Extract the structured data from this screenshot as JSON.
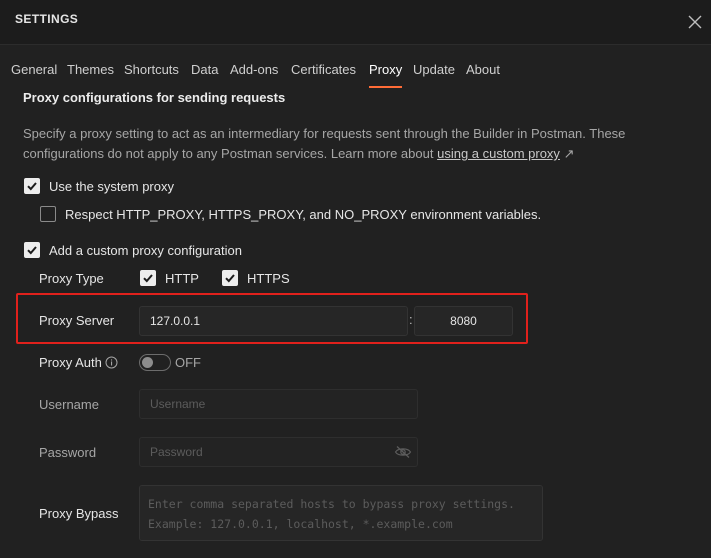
{
  "window": {
    "title": "SETTINGS"
  },
  "tabs": [
    {
      "label": "General"
    },
    {
      "label": "Themes"
    },
    {
      "label": "Shortcuts"
    },
    {
      "label": "Data"
    },
    {
      "label": "Add-ons"
    },
    {
      "label": "Certificates"
    },
    {
      "label": "Proxy",
      "active": true
    },
    {
      "label": "Update"
    },
    {
      "label": "About"
    }
  ],
  "section": {
    "title": "Proxy configurations for sending requests",
    "description": "Specify a proxy setting to act as an intermediary for requests sent through the Builder in Postman. These configurations do not apply to any Postman services. Learn more about",
    "link_text": "using a custom proxy",
    "link_arrow": "↗"
  },
  "system_proxy": {
    "label": "Use the system proxy",
    "checked": true
  },
  "respect_env": {
    "label": "Respect HTTP_PROXY, HTTPS_PROXY, and NO_PROXY environment variables.",
    "checked": false
  },
  "custom_proxy": {
    "label": "Add a custom proxy configuration",
    "checked": true
  },
  "proxy_type": {
    "label": "Proxy Type",
    "http": {
      "label": "HTTP",
      "checked": true
    },
    "https": {
      "label": "HTTPS",
      "checked": true
    }
  },
  "proxy_server": {
    "label": "Proxy Server",
    "host": "127.0.0.1",
    "separator": ":",
    "port": "8080"
  },
  "proxy_auth": {
    "label": "Proxy Auth",
    "state_label": "OFF",
    "enabled": false
  },
  "username": {
    "label": "Username",
    "placeholder": "Username"
  },
  "password": {
    "label": "Password",
    "placeholder": "Password"
  },
  "bypass": {
    "label": "Proxy Bypass",
    "placeholder": "Enter comma separated hosts to bypass proxy settings.\nExample: 127.0.0.1, localhost, *.example.com"
  },
  "colors": {
    "accent": "#ff6c37",
    "highlight_border": "#e0211c",
    "background": "#212121"
  }
}
